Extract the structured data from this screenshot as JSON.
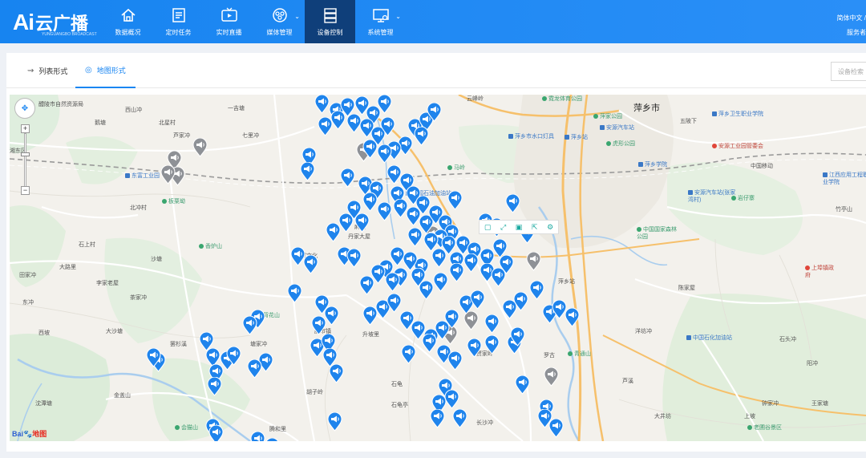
{
  "app": {
    "logo_ai": "Ai",
    "logo_cn": "云广播",
    "logo_sub": "YUNGUANGBO BROADCAST"
  },
  "nav": [
    {
      "label": "数据概况",
      "icon": "home-icon"
    },
    {
      "label": "定时任务",
      "icon": "list-icon"
    },
    {
      "label": "实时直播",
      "icon": "live-tv-icon"
    },
    {
      "label": "媒体管理",
      "icon": "media-icon",
      "dropdown": true
    },
    {
      "label": "设备控制",
      "icon": "server-icon",
      "active": true
    },
    {
      "label": "系统管理",
      "icon": "monitor-icon",
      "dropdown": true
    }
  ],
  "user": {
    "lang": "简体中文 / ",
    "role": "服务者"
  },
  "tabs": [
    {
      "label": "列表形式",
      "icon": "list-view-icon"
    },
    {
      "label": "地图形式",
      "icon": "map-pin-icon",
      "active": true
    }
  ],
  "search": {
    "placeholder": "设备检索"
  },
  "map": {
    "city": "萍乡市",
    "labels": [
      "醴陵市自然资源局",
      "西山冲",
      "一吉塘",
      "北星村",
      "鹅塘",
      "芦家冲",
      "七里冲",
      "霓龙体育公园",
      "云峰岭",
      "萍家公园",
      "萍乡市水口灯具",
      "萍乡站",
      "安源汽车站",
      "虎形公园",
      "五陂下",
      "萍乡卫生职业学院",
      "安源工业园管委会",
      "中国移动",
      "萍乡学院",
      "江西应用工程职业学院",
      "安源汽车站(张家湾村)",
      "岩仔寨",
      "竹亭山",
      "东富工业园",
      "板栗坳",
      "北冲村",
      "麻山",
      "石上村",
      "香炉山",
      "中国石油加油站",
      "马岭",
      "丹家大屋",
      "甸家文化",
      "沙塘",
      "李家老屋",
      "茶家冲",
      "大沙塘",
      "罢杉溪",
      "西坡",
      "陈家屋",
      "上埠镇政府",
      "背花山",
      "腊市镇",
      "升坡里",
      "贾家岭",
      "塘家冲",
      "罗古",
      "青通山",
      "中国石化加油站",
      "大井坊",
      "石龟",
      "沈潭塘",
      "长沙冲",
      "胡子岭",
      "石龟亭",
      "金盖山",
      "会猫山",
      "腾和里",
      "老圃谷景区",
      "钟家冲",
      "上坡",
      "王家塘",
      "阳冲",
      "洋坊冲",
      "石头冲",
      "萍乡站",
      "芦溪",
      "湘东区",
      "东冲",
      "田家冲",
      "大路里",
      "中国国家森林公园"
    ],
    "toolbar_icons": [
      "copy-icon",
      "fullscreen-icon",
      "save-icon",
      "share-icon",
      "settings-icon"
    ],
    "attribution_a": "Bai",
    "attribution_b": "地图"
  }
}
